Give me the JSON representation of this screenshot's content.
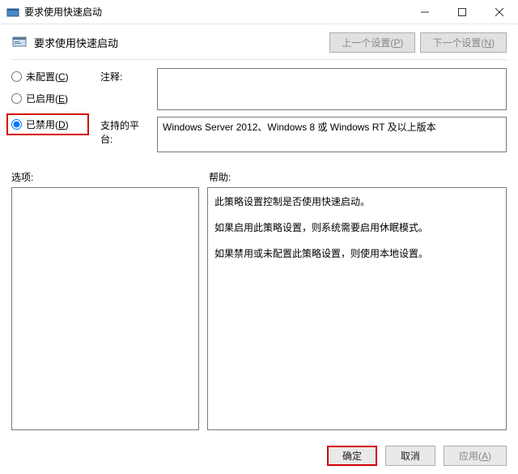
{
  "window": {
    "title": "要求使用快速启动"
  },
  "header": {
    "label": "要求使用快速启动",
    "prev_button": "上一个设置(P)",
    "next_button": "下一个设置(N)"
  },
  "radios": {
    "not_configured": "未配置(C)",
    "enabled": "已启用(E)",
    "disabled": "已禁用(D)",
    "selected": "disabled"
  },
  "fields": {
    "comment_label": "注释:",
    "comment_value": "",
    "platform_label": "支持的平台:",
    "platform_value": "Windows Server 2012、Windows 8 或 Windows RT 及以上版本"
  },
  "sections": {
    "options_label": "选项:",
    "help_label": "帮助:"
  },
  "help": {
    "p1": "此策略设置控制是否使用快速启动。",
    "p2": "如果启用此策略设置，则系统需要启用休眠模式。",
    "p3": "如果禁用或未配置此策略设置，则使用本地设置。"
  },
  "footer": {
    "ok": "确定",
    "cancel": "取消",
    "apply": "应用(A)"
  }
}
